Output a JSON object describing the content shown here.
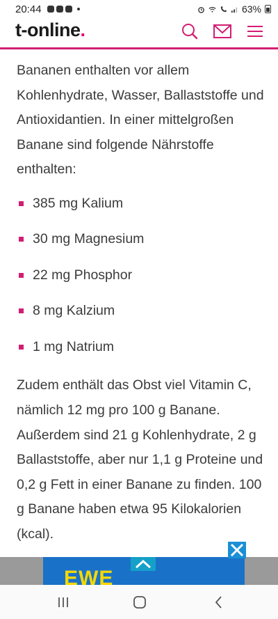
{
  "status_bar": {
    "time": "20:44",
    "battery": "63%"
  },
  "header": {
    "logo_text": "t-online",
    "logo_dot": ".",
    "accent_color": "#d21d72"
  },
  "article": {
    "intro": "Bananen enthalten vor allem Kohlenhydrate, Wasser, Ballaststoffe und Antioxidantien. In einer mittelgroßen Banane sind folgende Nährstoffe enthalten:",
    "nutrients": [
      "385 mg Kalium",
      "30 mg Magnesium",
      "22 mg Phosphor",
      "8 mg Kalzium",
      "1 mg Natrium"
    ],
    "paragraph2": "Zudem enthält das Obst viel Vitamin C, nämlich 12 mg pro 100 g Banane. Außerdem sind 21 g Kohlenhydrate, 2 g Ballaststoffe, aber nur 1,1 g Proteine und 0,2 g Fett in einer Banane zu finden. 100 g Banane haben etwa 95 Kilokalorien (kcal)."
  },
  "ad": {
    "text": "EWE",
    "icons": [
      "chevron-up-icon",
      "close-icon"
    ]
  },
  "navigation": {
    "icons": [
      "recent-apps-icon",
      "home-icon",
      "back-icon"
    ]
  }
}
